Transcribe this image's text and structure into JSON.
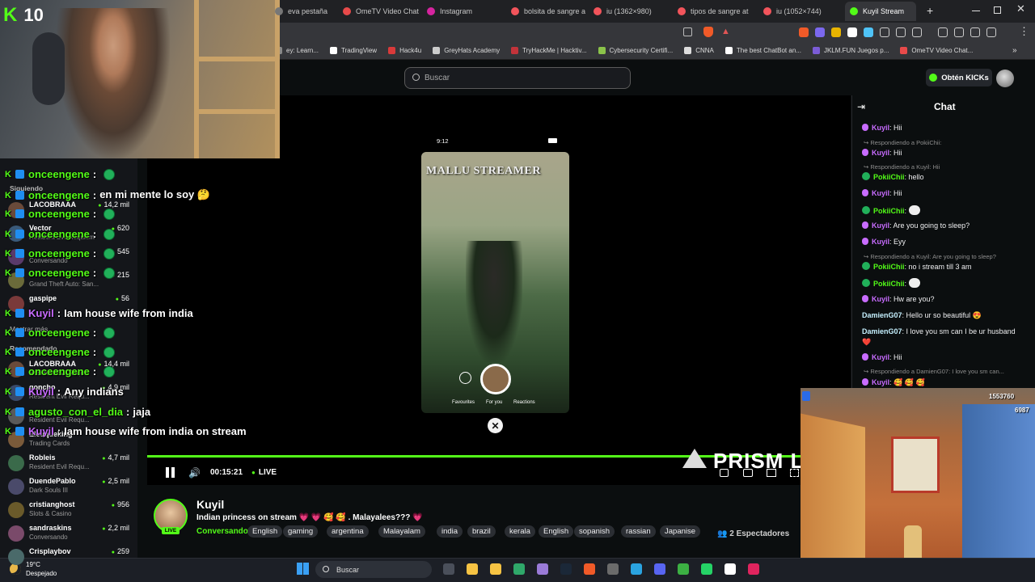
{
  "browser": {
    "tabs": [
      {
        "label": "eva pestaña",
        "color": "#777777"
      },
      {
        "label": "OmeTV Video Chat",
        "color": "#e84a4a"
      },
      {
        "label": "Instagram",
        "color": "#d6249f"
      },
      {
        "label": "bolsita de sangre a",
        "color": "#f2545b"
      },
      {
        "label": "iu (1362×980)",
        "color": "#f2545b"
      },
      {
        "label": "tipos de sangre at",
        "color": "#f2545b"
      },
      {
        "label": "iu (1052×744)",
        "color": "#f2545b"
      },
      {
        "label": "Kuyil Stream",
        "color": "#53fc18"
      }
    ],
    "bookmarks": [
      {
        "label": "ey: Learn...",
        "color": "#888888"
      },
      {
        "label": "TradingView",
        "color": "#ffffff"
      },
      {
        "label": "Hack4u",
        "color": "#d93a3a"
      },
      {
        "label": "GreyHats Academy",
        "color": "#cccccc"
      },
      {
        "label": "TryHackMe | Hacktiv...",
        "color": "#c2333a"
      },
      {
        "label": "Cybersecurity Certifi...",
        "color": "#8bc34a"
      },
      {
        "label": "CNNA",
        "color": "#dddddd"
      },
      {
        "label": "The best ChatBot an...",
        "color": "#ffffff"
      },
      {
        "label": "JKLM.FUN Juegos p...",
        "color": "#7b5cd6"
      },
      {
        "label": "OmeTV Video Chat...",
        "color": "#e84a4a"
      }
    ]
  },
  "header": {
    "search_placeholder": "Buscar",
    "kicks_label": "Obtén KICKs"
  },
  "webcam": {
    "counter": "10"
  },
  "sidebar": {
    "following_label": "Siguiendo",
    "show_more": "Mostrar más",
    "recommended_label": "Recomendado",
    "following": [
      {
        "name": "LACOBRAAA",
        "category": "",
        "viewers": "14,2 mil",
        "color": "#6a4a3a"
      },
      {
        "name": "Vector",
        "category": "Resident Evil Requiem",
        "viewers": "620",
        "color": "#3a5a7a"
      },
      {
        "name": "",
        "category": "Conversando",
        "viewers": "545",
        "color": "#5a3a6a"
      },
      {
        "name": "",
        "category": "Grand Theft Auto: San...",
        "viewers": "215",
        "color": "#6a6a3a"
      },
      {
        "name": "gaspipe",
        "category": "",
        "viewers": "56",
        "color": "#7a3a3a"
      }
    ],
    "recommended": [
      {
        "name": "LACOBRAAA",
        "category": "Resident Evil Requ...",
        "viewers": "14,4 mil",
        "color": "#6a4a3a"
      },
      {
        "name": "goncho",
        "category": "Resident Evil Requ...",
        "viewers": "4,9 mil",
        "color": "#3a4a6a"
      },
      {
        "name": "",
        "category": "Resident Evil Requ...",
        "viewers": "",
        "color": "#5a5a5a"
      },
      {
        "name": "Elcuqueking",
        "category": "Trading Cards",
        "viewers": "",
        "color": "#7a5a3a"
      },
      {
        "name": "Robleis",
        "category": "Resident Evil Requ...",
        "viewers": "4,7 mil",
        "color": "#3a6a4a"
      },
      {
        "name": "DuendePablo",
        "category": "Dark Souls III",
        "viewers": "2,5 mil",
        "color": "#4a4a6a"
      },
      {
        "name": "cristianghost",
        "category": "Slots & Casino",
        "viewers": "956",
        "color": "#6a5a2a"
      },
      {
        "name": "sandraskins",
        "category": "Conversando",
        "viewers": "2,2 mil",
        "color": "#7a4a6a"
      },
      {
        "name": "Crisplaybov",
        "category": "",
        "viewers": "259",
        "color": "#4a6a6a"
      }
    ]
  },
  "overlay_chat": [
    {
      "user": "onceengene",
      "text": "",
      "kuyil": false
    },
    {
      "user": "onceengene",
      "text": "en mi mente lo soy 🤔",
      "kuyil": false
    },
    {
      "user": "onceengene",
      "text": "",
      "kuyil": false
    },
    {
      "user": "onceengene",
      "text": "",
      "kuyil": false
    },
    {
      "user": "onceengene",
      "text": "",
      "kuyil": false
    },
    {
      "user": "onceengene",
      "text": "",
      "kuyil": false
    },
    {
      "user": "Kuyil",
      "text": "Iam house wife from india",
      "kuyil": true
    },
    {
      "user": "onceengene",
      "text": "",
      "kuyil": false
    },
    {
      "user": "onceengene",
      "text": "",
      "kuyil": false
    },
    {
      "user": "onceengene",
      "text": "",
      "kuyil": false
    },
    {
      "user": "Kuyil",
      "text": "Any indians",
      "kuyil": true
    },
    {
      "user": "agusto_con_el_dia",
      "text": "jaja",
      "kuyil": false
    },
    {
      "user": "Kuyil",
      "text": "Iam house wife from india on stream",
      "kuyil": true
    }
  ],
  "video": {
    "phone_time": "9:12",
    "phone_title": "MALLU STREAMER",
    "phone_tabs": [
      "Favourites",
      "For you",
      "Reactions"
    ],
    "elapsed": "00:15:21",
    "live_label": "LIVE",
    "brand_text": "PRISM L"
  },
  "stream": {
    "streamer": "Kuyil",
    "title": "Indian princess on stream 💗 💗 🥰 🥰 . Malayalees??? 💗",
    "category": "Conversando",
    "live_badge": "LIVE",
    "tags": [
      "English",
      "gaming",
      "argentina",
      "Malayalam",
      "india",
      "brazil",
      "kerala",
      "English",
      "sopanish",
      "rassian",
      "Japanise"
    ],
    "viewers": "2 Espectadores"
  },
  "chat": {
    "title": "Chat",
    "messages": [
      {
        "type": "msg",
        "user": "Kuyil",
        "style": "u1",
        "badge": "mic",
        "text": "Hii"
      },
      {
        "type": "reply",
        "text": "Respondiendo a PokiiChii:"
      },
      {
        "type": "msg",
        "user": "Kuyil",
        "style": "u1",
        "badge": "mic",
        "text": "Hii"
      },
      {
        "type": "reply",
        "text": "Respondiendo a Kuyil: Hii"
      },
      {
        "type": "msg",
        "user": "PokiiChii",
        "style": "u2",
        "badge": "chk",
        "text": "hello"
      },
      {
        "type": "msg",
        "user": "Kuyil",
        "style": "u1",
        "badge": "mic",
        "text": "Hii"
      },
      {
        "type": "msg",
        "user": "PokiiChii",
        "style": "u2",
        "badge": "chk",
        "text": ""
      },
      {
        "type": "msg",
        "user": "Kuyil",
        "style": "u1",
        "badge": "mic",
        "text": "Are you going to sleep?"
      },
      {
        "type": "msg",
        "user": "Kuyil",
        "style": "u1",
        "badge": "mic",
        "text": "Eyy"
      },
      {
        "type": "reply",
        "text": "Respondiendo a Kuyil: Are you going to sleep?"
      },
      {
        "type": "msg",
        "user": "PokiiChii",
        "style": "u2",
        "badge": "chk",
        "text": "no i stream till 3 am"
      },
      {
        "type": "msg",
        "user": "PokiiChii",
        "style": "u2",
        "badge": "chk",
        "text": ""
      },
      {
        "type": "msg",
        "user": "Kuyil",
        "style": "u1",
        "badge": "mic",
        "text": "Hw are you?"
      },
      {
        "type": "msg",
        "user": "DamienG07",
        "style": "u3",
        "badge": "",
        "text": "Hello ur so beautiful 😍"
      },
      {
        "type": "msg",
        "user": "DamienG07",
        "style": "u3",
        "badge": "",
        "text": "I love you sm can I be ur husband ❤️"
      },
      {
        "type": "msg",
        "user": "Kuyil",
        "style": "u1",
        "badge": "mic",
        "text": "Hii"
      },
      {
        "type": "reply",
        "text": "Respondiendo a DamienG07: I love you sm can..."
      },
      {
        "type": "msg",
        "user": "Kuyil",
        "style": "u1",
        "badge": "mic",
        "text": "🥰 🥰 🥰"
      }
    ]
  },
  "game": {
    "score": "1553760",
    "coins": "6987"
  },
  "taskbar": {
    "temp": "19°C",
    "weather": "Despejado",
    "search": "Buscar"
  }
}
